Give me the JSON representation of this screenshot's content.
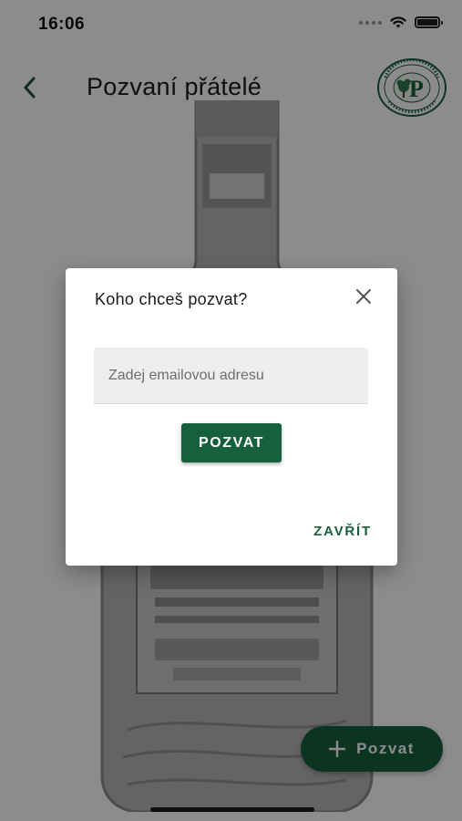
{
  "status_bar": {
    "time": "16:06",
    "icons": [
      "cellular-signal-icon",
      "wifi-icon",
      "battery-icon"
    ]
  },
  "header": {
    "title": "Pozvaní přátelé",
    "back_icon": "chevron-left-icon",
    "logo": {
      "letter": "P",
      "ring_text": "PÁLENA U ZELENÉHO STROMU · PROSTĚJOV"
    }
  },
  "background": {
    "illustration": "bottle-image"
  },
  "fab": {
    "icon": "plus-icon",
    "label": "Pozvat"
  },
  "dialog": {
    "title": "Koho chceš pozvat?",
    "close_icon": "close-icon",
    "email": {
      "value": "",
      "placeholder": "Zadej emailovou adresu"
    },
    "invite_label": "POZVAT",
    "close_label": "ZAVŘÍT"
  },
  "colors": {
    "brand_green": "#16603e",
    "scrim": "rgba(0,0,0,0.45)",
    "field_bg": "#eeeeee"
  }
}
